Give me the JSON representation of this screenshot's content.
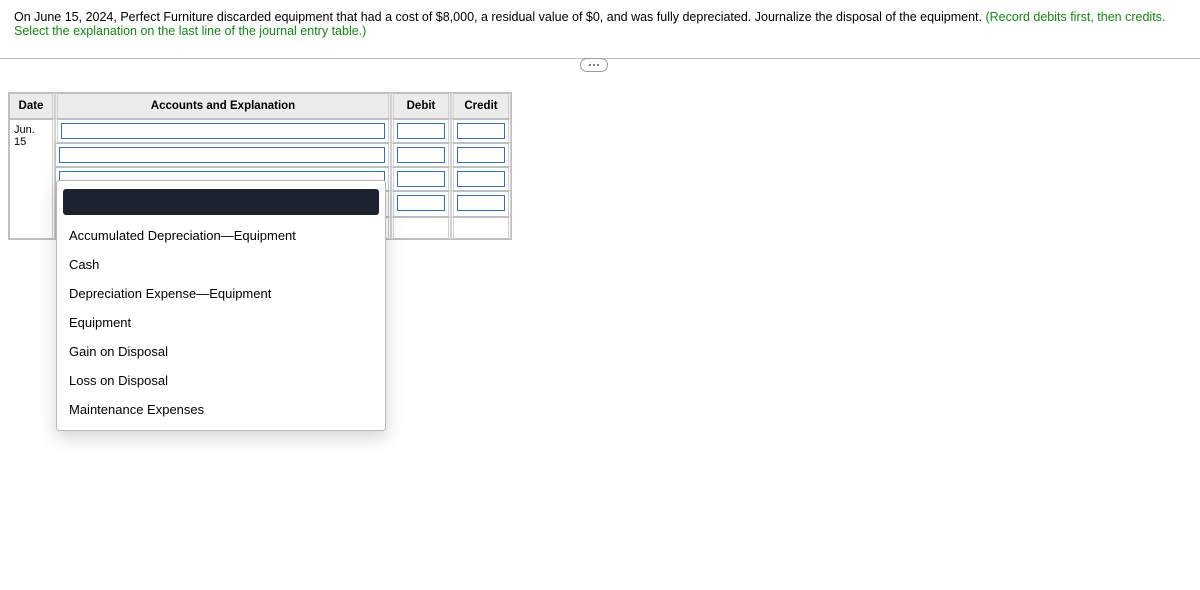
{
  "question": {
    "text": "On June 15, 2024, Perfect Furniture discarded equipment that had a cost of $8,000, a residual value of $0, and was fully depreciated. Journalize the disposal of the equipment. ",
    "instruction": "(Record debits first, then credits. Select the explanation on the last line of the journal entry table.)"
  },
  "table": {
    "headers": {
      "date": "Date",
      "accounts": "Accounts and Explanation",
      "debit": "Debit",
      "credit": "Credit"
    },
    "rows": [
      {
        "date": "Jun. 15",
        "account": "",
        "debit": "",
        "credit": ""
      },
      {
        "date": "",
        "account": "",
        "debit": "",
        "credit": ""
      },
      {
        "date": "",
        "account": "",
        "debit": "",
        "credit": ""
      },
      {
        "date": "",
        "account": "",
        "debit": "",
        "credit": ""
      }
    ]
  },
  "dropdown": {
    "options": [
      "",
      "Accumulated Depreciation—Equipment",
      "Cash",
      "Depreciation Expense—Equipment",
      "Equipment",
      "Gain on Disposal",
      "Loss on Disposal",
      "Maintenance Expenses"
    ]
  }
}
